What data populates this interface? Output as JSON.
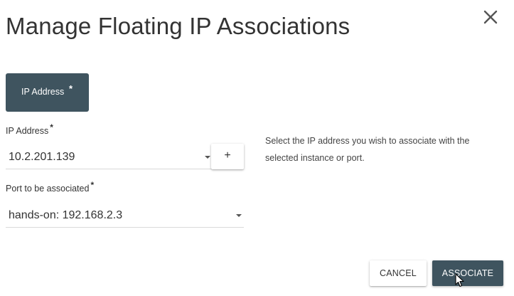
{
  "dialog": {
    "title": "Manage Floating IP Associations",
    "close_icon": "close-icon"
  },
  "tabs": [
    {
      "label": "IP Address",
      "required_mark": "*",
      "active": true
    }
  ],
  "form": {
    "ip_address": {
      "label": "IP Address",
      "required_mark": "*",
      "value": "10.2.201.139",
      "add_button_label": "+"
    },
    "port": {
      "label": "Port to be associated",
      "required_mark": "*",
      "value": "hands-on: 192.168.2.3"
    },
    "help_text": "Select the IP address you wish to associate with the selected instance or port."
  },
  "footer": {
    "cancel_label": "CANCEL",
    "associate_label": "ASSOCIATE"
  },
  "colors": {
    "primary_dark": "#3f545f",
    "text": "#333333",
    "divider": "#d9d9d9"
  }
}
